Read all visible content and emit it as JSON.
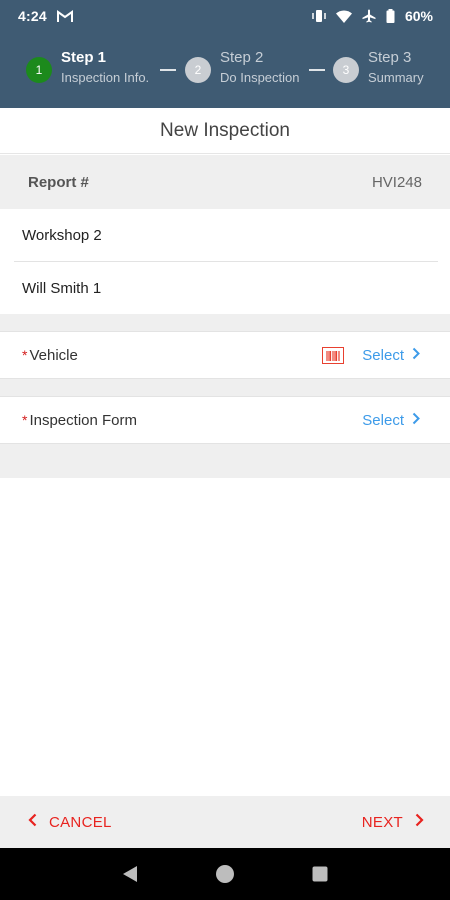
{
  "status_bar": {
    "time": "4:24",
    "battery": "60%",
    "icons": [
      "gmail-icon",
      "vibrate-icon",
      "wifi-icon",
      "airplane-icon",
      "battery-icon"
    ]
  },
  "stepper": {
    "steps": [
      {
        "number": "1",
        "title": "Step 1",
        "subtitle": "Inspection Info.",
        "state": "active"
      },
      {
        "number": "2",
        "title": "Step 2",
        "subtitle": "Do Inspection",
        "state": "inactive"
      },
      {
        "number": "3",
        "title": "Step 3",
        "subtitle": "Summary",
        "state": "inactive"
      }
    ]
  },
  "page": {
    "title": "New Inspection"
  },
  "report": {
    "label": "Report #",
    "value": "HVI248"
  },
  "info_rows": [
    "Workshop 2",
    "Will Smith 1"
  ],
  "vehicle": {
    "required_mark": "*",
    "label": "Vehicle",
    "action": "Select",
    "icon": "barcode-icon"
  },
  "inspection_form": {
    "required_mark": "*",
    "label": "Inspection Form",
    "action": "Select"
  },
  "footer": {
    "cancel": "CANCEL",
    "next": "NEXT"
  },
  "colors": {
    "header_bg": "#3f5b73",
    "active_step": "#1c8a1c",
    "accent_red": "#e8231f",
    "link_blue": "#3d9be9"
  }
}
